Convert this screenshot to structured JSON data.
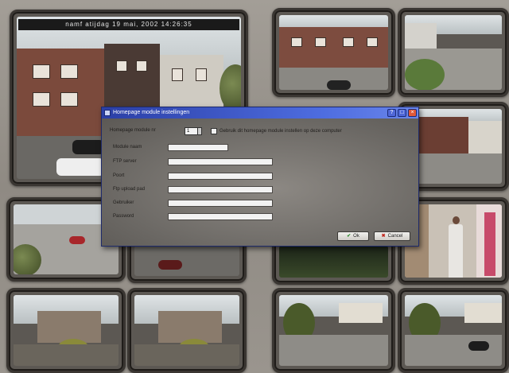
{
  "camera_main": {
    "overlay": "namf     atijdag 19 mai, 2002   14:26:35"
  },
  "dialog": {
    "title": "Homepage module instellingen",
    "module_label": "Homepage module nr",
    "module_value": "1",
    "checkbox_label": "Gebruik dit homepage module instellen op deze computer",
    "fields": [
      {
        "label": "Module naam",
        "value": ""
      },
      {
        "label": "FTP server",
        "value": ""
      },
      {
        "label": "Poort",
        "value": ""
      },
      {
        "label": "Ftp upload pad",
        "value": ""
      },
      {
        "label": "Gebruiker",
        "value": ""
      },
      {
        "label": "Password",
        "value": ""
      }
    ],
    "ok_label": "Ok",
    "cancel_label": "Cancel"
  }
}
